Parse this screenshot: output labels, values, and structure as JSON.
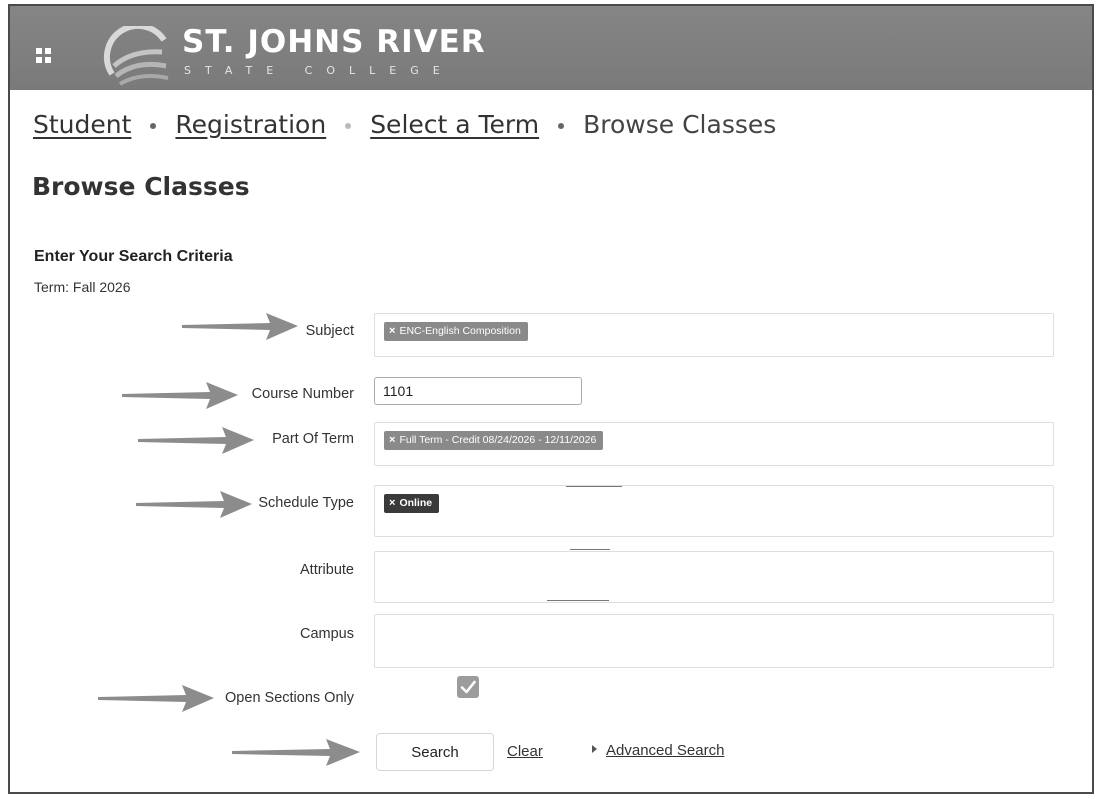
{
  "header": {
    "logo_name": "ST. JOHNS RIVER",
    "logo_sub": "STATE COLLEGE"
  },
  "breadcrumb": {
    "items": [
      "Student",
      "Registration",
      "Select a Term"
    ],
    "current": "Browse Classes"
  },
  "page": {
    "title": "Browse Classes",
    "section_title": "Enter Your Search Criteria",
    "term_line": "Term: Fall 2026"
  },
  "form": {
    "subject": {
      "label": "Subject",
      "chip": "ENC-English Composition"
    },
    "course_number": {
      "label": "Course Number",
      "value": "1101"
    },
    "part_of_term": {
      "label": "Part Of Term",
      "chip": "Full Term - Credit 08/24/2026 - 12/11/2026"
    },
    "schedule_type": {
      "label": "Schedule Type",
      "chip": "Online"
    },
    "attribute": {
      "label": "Attribute"
    },
    "campus": {
      "label": "Campus"
    },
    "open_sections": {
      "label": "Open Sections Only",
      "checked": true
    }
  },
  "actions": {
    "search": "Search",
    "clear": "Clear",
    "advanced": "Advanced Search"
  },
  "chip_remove_glyph": "×",
  "colors": {
    "header": "#808080",
    "chip_grey": "#8a8a8a",
    "chip_dark": "#3a3a3a",
    "arrow": "#8c8c8c"
  }
}
